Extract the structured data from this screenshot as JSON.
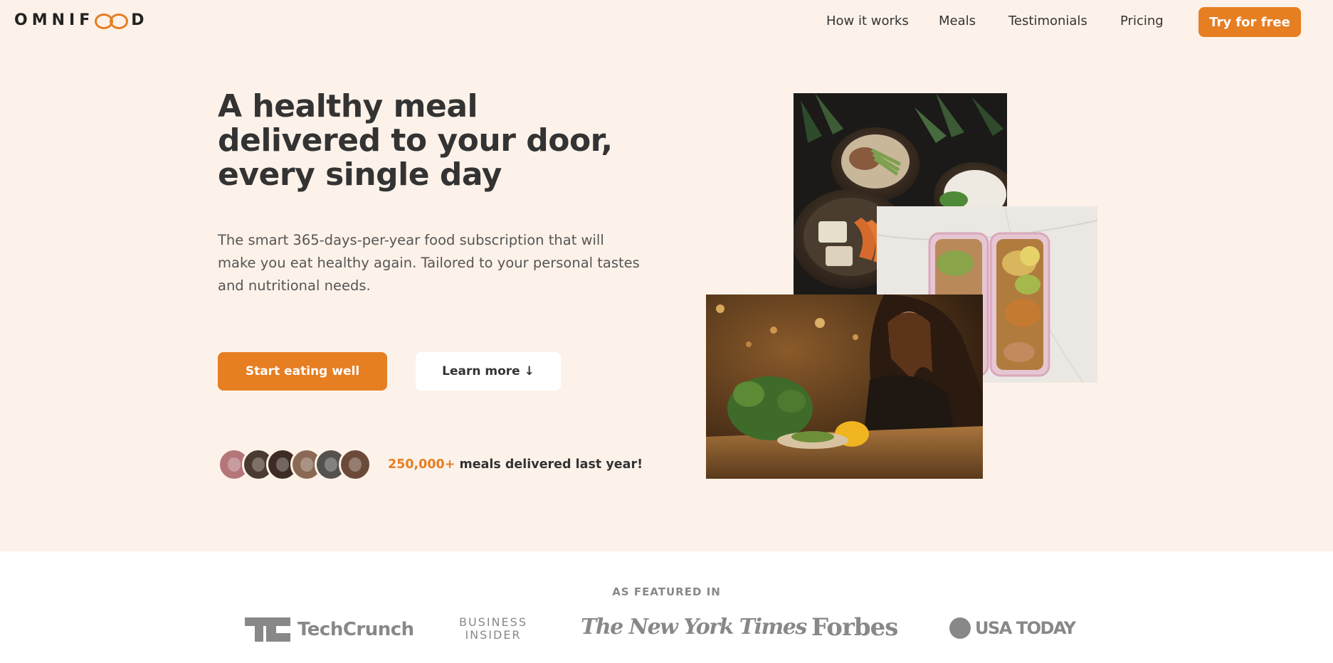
{
  "header": {
    "logo_left": "OMNIF",
    "logo_right": "D",
    "nav": [
      "How it works",
      "Meals",
      "Testimonials",
      "Pricing"
    ],
    "cta": "Try for free"
  },
  "hero": {
    "title": "A healthy meal delivered to your door, every single day",
    "description": "The smart 365-days-per-year food subscription that will make you eat healthy again. Tailored to your personal tastes and nutritional needs.",
    "primary_button": "Start eating well",
    "secondary_button": "Learn more ↓",
    "delivered_count": "250,000+",
    "delivered_text": " meals delivered last year!",
    "avatar_colors": [
      "#b5767a",
      "#4a3a30",
      "#3d2b24",
      "#8a6a55",
      "#55514e",
      "#6b4a3a"
    ],
    "images": [
      "bowls-photo",
      "meal-prep-boxes-photo",
      "woman-eating-photo"
    ]
  },
  "featured": {
    "label": "AS FEATURED IN",
    "logos": {
      "techcrunch": "TechCrunch",
      "business_insider_1": "BUSINESS",
      "business_insider_2": "INSIDER",
      "nyt": "The New York Times",
      "forbes": "Forbes",
      "usa_today": "USA TODAY"
    }
  },
  "colors": {
    "accent": "#e67e22",
    "hero_bg": "#fdf2e9",
    "text": "#333333",
    "logo_gray": "#888888"
  }
}
